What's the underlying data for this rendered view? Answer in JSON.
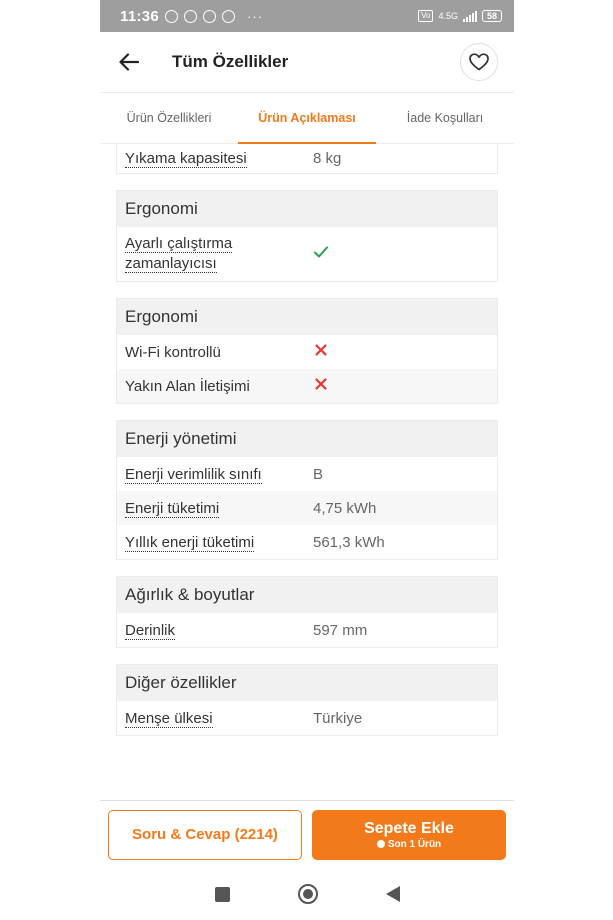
{
  "status_bar": {
    "time": "11:36",
    "dots": "···",
    "network": "4.5G",
    "battery": "58"
  },
  "header": {
    "title": "Tüm Özellikler"
  },
  "tabs": [
    {
      "label": "Ürün Özellikleri",
      "active": false
    },
    {
      "label": "Ürün Açıklaması",
      "active": true
    },
    {
      "label": "İade Koşulları",
      "active": false
    }
  ],
  "spec_groups": [
    {
      "rows": [
        {
          "label": "Yıkama kapasitesi",
          "value": "8 kg"
        }
      ]
    },
    {
      "title": "Ergonomi",
      "rows": [
        {
          "label": "Ayarlı çalıştırma zamanlayıcısı",
          "value_icon": "check-icon"
        }
      ]
    },
    {
      "title": "Ergonomi",
      "rows": [
        {
          "label": "Wi-Fi kontrollü",
          "value_icon": "cross-icon"
        },
        {
          "label": "Yakın Alan İletişimi",
          "value_icon": "cross-icon"
        }
      ]
    },
    {
      "title": "Enerji yönetimi",
      "rows": [
        {
          "label": "Enerji verimlilik sınıfı",
          "value": "B"
        },
        {
          "label": "Enerji tüketimi",
          "value": "4,75 kWh"
        },
        {
          "label": "Yıllık enerji tüketimi",
          "value": "561,3 kWh"
        }
      ]
    },
    {
      "title": "Ağırlık & boyutlar",
      "rows": [
        {
          "label": "Derinlik",
          "value": "597 mm"
        }
      ]
    },
    {
      "title": "Diğer özellikler",
      "rows": [
        {
          "label": "Menşe ülkesi",
          "value": "Türkiye"
        }
      ]
    }
  ],
  "bottom_bar": {
    "qa_label": "Soru & Cevap (2214)",
    "cart_label": "Sepete Ekle",
    "cart_sub": "Son 1 Ürün"
  },
  "colors": {
    "accent": "#f27a1a",
    "check": "#2e9e4f",
    "cross": "#e53935"
  }
}
